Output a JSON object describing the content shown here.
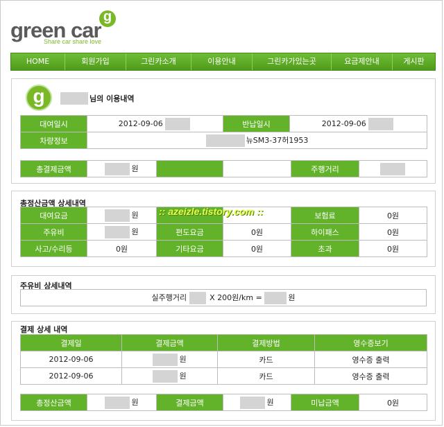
{
  "brand": {
    "logo_text": "green car",
    "logo_badge": "g",
    "tagline": "Share car share love",
    "accent": "#63b32a"
  },
  "nav": {
    "items": [
      {
        "label": "HOME"
      },
      {
        "label": "회원가입"
      },
      {
        "label": "그린카소개"
      },
      {
        "label": "이용안내"
      },
      {
        "label": "그린카가있는곳"
      },
      {
        "label": "요금제안내"
      },
      {
        "label": "게시판"
      }
    ]
  },
  "usage": {
    "badge": "g",
    "title_suffix": "님의 이용내역",
    "rent_label": "대여일시",
    "rent_date": "2012-09-06",
    "return_label": "반납일시",
    "return_date": "2012-09-06",
    "car_label": "차량정보",
    "car_value": "뉴SM3-37허1953",
    "total_label": "총결제금액",
    "total_unit": "원",
    "distance_label": "주행거리"
  },
  "settlement": {
    "title": "총정산금액 상세내역",
    "watermark": ":: azeizle.tistory.com ::",
    "rows": [
      [
        {
          "label": "대여요금",
          "value": "원",
          "masked": true
        },
        {
          "label": "",
          "value": "",
          "masked": false
        },
        {
          "label": "보험료",
          "value": "0원",
          "masked": false
        }
      ],
      [
        {
          "label": "주유비",
          "value": "원",
          "masked": true
        },
        {
          "label": "편도요금",
          "value": "0원",
          "masked": false
        },
        {
          "label": "하이패스",
          "value": "0원",
          "masked": false
        }
      ],
      [
        {
          "label": "사고/수리등",
          "value": "0원",
          "masked": false
        },
        {
          "label": "기타요금",
          "value": "0원",
          "masked": false
        },
        {
          "label": "초과",
          "value": "0원",
          "masked": false
        }
      ]
    ]
  },
  "fuel": {
    "title": "주유비 상세내역",
    "prefix": "실주행거리",
    "middle": "X 200원/km =",
    "suffix": "원"
  },
  "payment": {
    "title": "결제 상세 내역",
    "headers": [
      "결제일",
      "결제금액",
      "결제방법",
      "영수증보기"
    ],
    "rows": [
      {
        "date": "2012-09-06",
        "amount_unit": "원",
        "method": "카드",
        "receipt": "영수증 출력"
      },
      {
        "date": "2012-09-06",
        "amount_unit": "원",
        "method": "카드",
        "receipt": "영수증 출력"
      }
    ],
    "summary": {
      "settle_label": "총정산금액",
      "settle_unit": "원",
      "paid_label": "결제금액",
      "paid_unit": "원",
      "unpaid_label": "미납금액",
      "unpaid_value": "0원"
    }
  }
}
